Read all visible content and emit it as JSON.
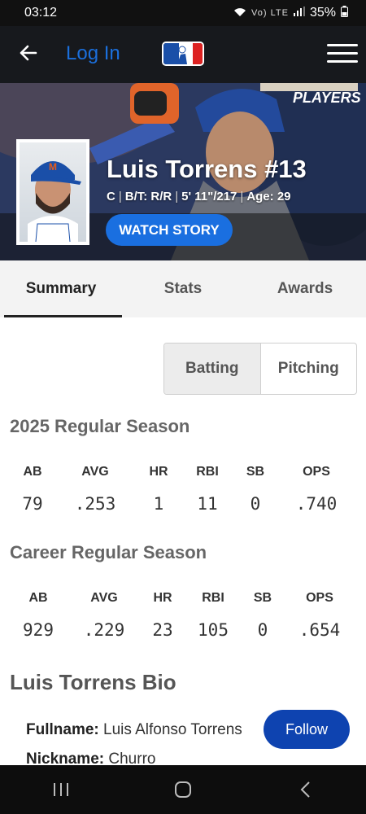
{
  "status_bar": {
    "time": "03:12",
    "battery": "35%",
    "icons": "Vo) LTE"
  },
  "nav": {
    "login_label": "Log In"
  },
  "hero": {
    "players_logo": "PLAYERS",
    "name": "Luis Torrens #13",
    "position": "C",
    "bats_throws": "B/T: R/R",
    "height_weight": "5' 11\"/217",
    "age": "Age: 29",
    "watch_label": "WATCH STORY"
  },
  "tabs": [
    {
      "label": "Summary",
      "active": true
    },
    {
      "label": "Stats",
      "active": false
    },
    {
      "label": "Awards",
      "active": false
    }
  ],
  "segment": {
    "batting": "Batting",
    "pitching": "Pitching"
  },
  "season": {
    "title": "2025 Regular Season",
    "headers": [
      "AB",
      "AVG",
      "HR",
      "RBI",
      "SB",
      "OPS"
    ],
    "values": [
      "79",
      ".253",
      "1",
      "11",
      "0",
      ".740"
    ]
  },
  "career": {
    "title": "Career Regular Season",
    "headers": [
      "AB",
      "AVG",
      "HR",
      "RBI",
      "SB",
      "OPS"
    ],
    "values": [
      "929",
      ".229",
      "23",
      "105",
      "0",
      ".654"
    ]
  },
  "bio": {
    "title": "Luis Torrens Bio",
    "fullname_label": "Fullname:",
    "fullname_value": "Luis Alfonso Torrens",
    "nickname_label": "Nickname:",
    "nickname_value": "Churro",
    "follow_label": "Follow"
  }
}
